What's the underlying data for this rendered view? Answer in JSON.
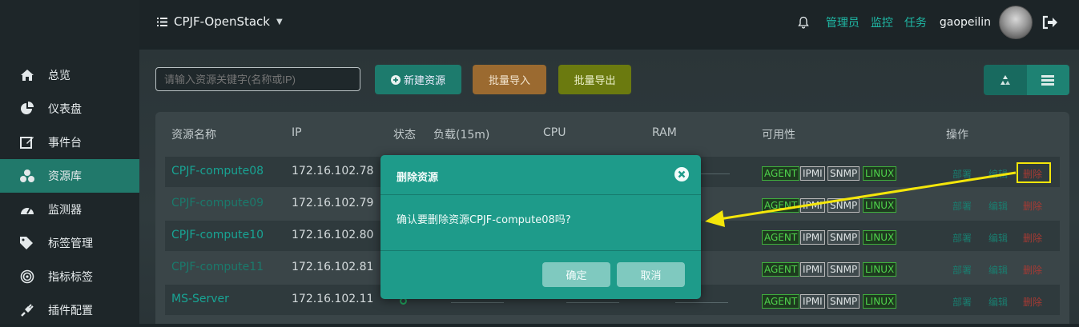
{
  "header": {
    "project": "CPJF-OpenStack",
    "links": [
      "管理员",
      "监控",
      "任务"
    ],
    "username": "gaopeilin"
  },
  "sidebar": {
    "items": [
      {
        "label": "总览"
      },
      {
        "label": "仪表盘"
      },
      {
        "label": "事件台"
      },
      {
        "label": "资源库",
        "active": true
      },
      {
        "label": "监测器"
      },
      {
        "label": "标签管理"
      },
      {
        "label": "指标标签"
      },
      {
        "label": "插件配置"
      }
    ]
  },
  "toolbar": {
    "search_placeholder": "请输入资源关键字(名称或IP)",
    "new_label": "新建资源",
    "import_label": "批量导入",
    "export_label": "批量导出"
  },
  "table": {
    "headers": [
      "资源名称",
      "IP",
      "状态",
      "负载(15m)",
      "CPU",
      "RAM",
      "可用性",
      "操作"
    ],
    "rows": [
      {
        "name": "CPJF-compute08",
        "ip": "172.16.102.78"
      },
      {
        "name": "CPJF-compute09",
        "ip": "172.16.102.79"
      },
      {
        "name": "CPJF-compute10",
        "ip": "172.16.102.80"
      },
      {
        "name": "CPJF-compute11",
        "ip": "172.16.102.81"
      },
      {
        "name": "MS-Server",
        "ip": "172.16.102.11"
      }
    ],
    "tags": [
      "AGENT",
      "IPMI",
      "SNMP",
      "LINUX"
    ],
    "actions": [
      "部署",
      "编辑",
      "删除"
    ]
  },
  "modal": {
    "title": "删除资源",
    "message": "确认要删除资源CPJF-compute08吗?",
    "ok_label": "确定",
    "cancel_label": "取消"
  },
  "colors": {
    "accent": "#1e9b8a",
    "active_nav": "#21796b",
    "highlight": "#f4e60a"
  }
}
